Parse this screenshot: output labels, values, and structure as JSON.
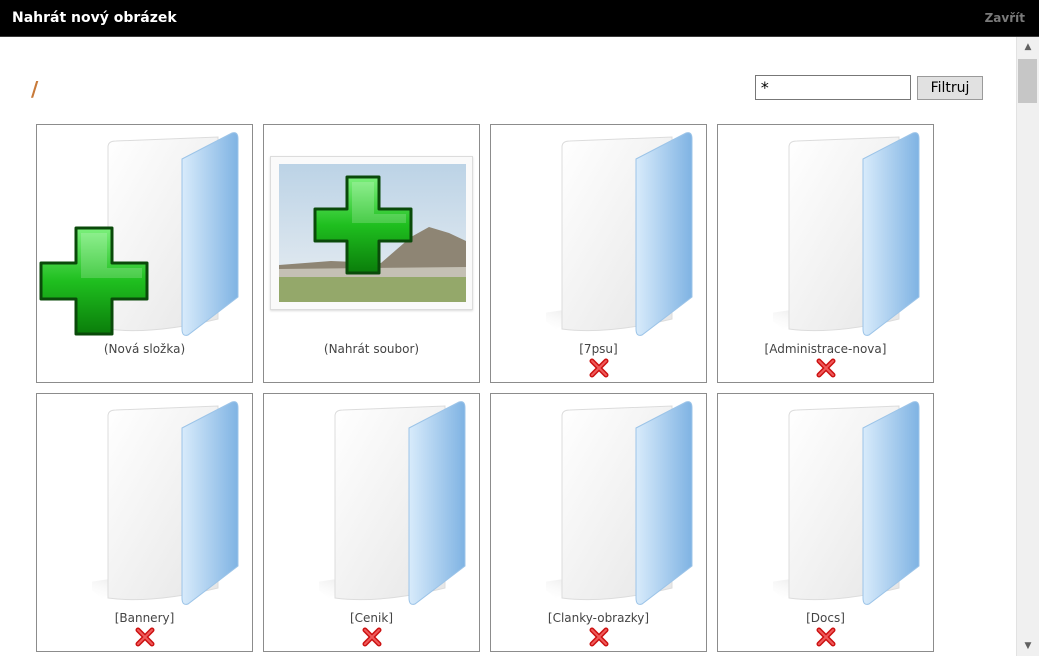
{
  "dialog": {
    "title": "Nahrát nový obrázek",
    "close_label": "Zavřít"
  },
  "browser": {
    "path": "/",
    "filter": {
      "value": "*",
      "button_label": "Filtruj"
    },
    "tiles": [
      {
        "label": "(Nová složka)",
        "kind": "new-folder",
        "deletable": false
      },
      {
        "label": "(Nahrát soubor)",
        "kind": "upload-file",
        "deletable": false
      },
      {
        "label": "[7psu]",
        "kind": "folder",
        "deletable": true
      },
      {
        "label": "[Administrace-nova]",
        "kind": "folder",
        "deletable": true
      },
      {
        "label": "[Bannery]",
        "kind": "folder",
        "deletable": true
      },
      {
        "label": "[Cenik]",
        "kind": "folder",
        "deletable": true
      },
      {
        "label": "[Clanky-obrazky]",
        "kind": "folder",
        "deletable": true
      },
      {
        "label": "[Docs]",
        "kind": "folder",
        "deletable": true
      }
    ]
  },
  "colors": {
    "titlebar_bg": "#000000",
    "path_color": "#c87a3a",
    "plus_green": "#1fbf1f",
    "delete_red": "#cc1111",
    "folder_blue": "#8ec0ea"
  },
  "icons": {
    "folder": "folder-icon",
    "plus": "green-plus-icon",
    "delete": "red-x-delete-icon"
  }
}
